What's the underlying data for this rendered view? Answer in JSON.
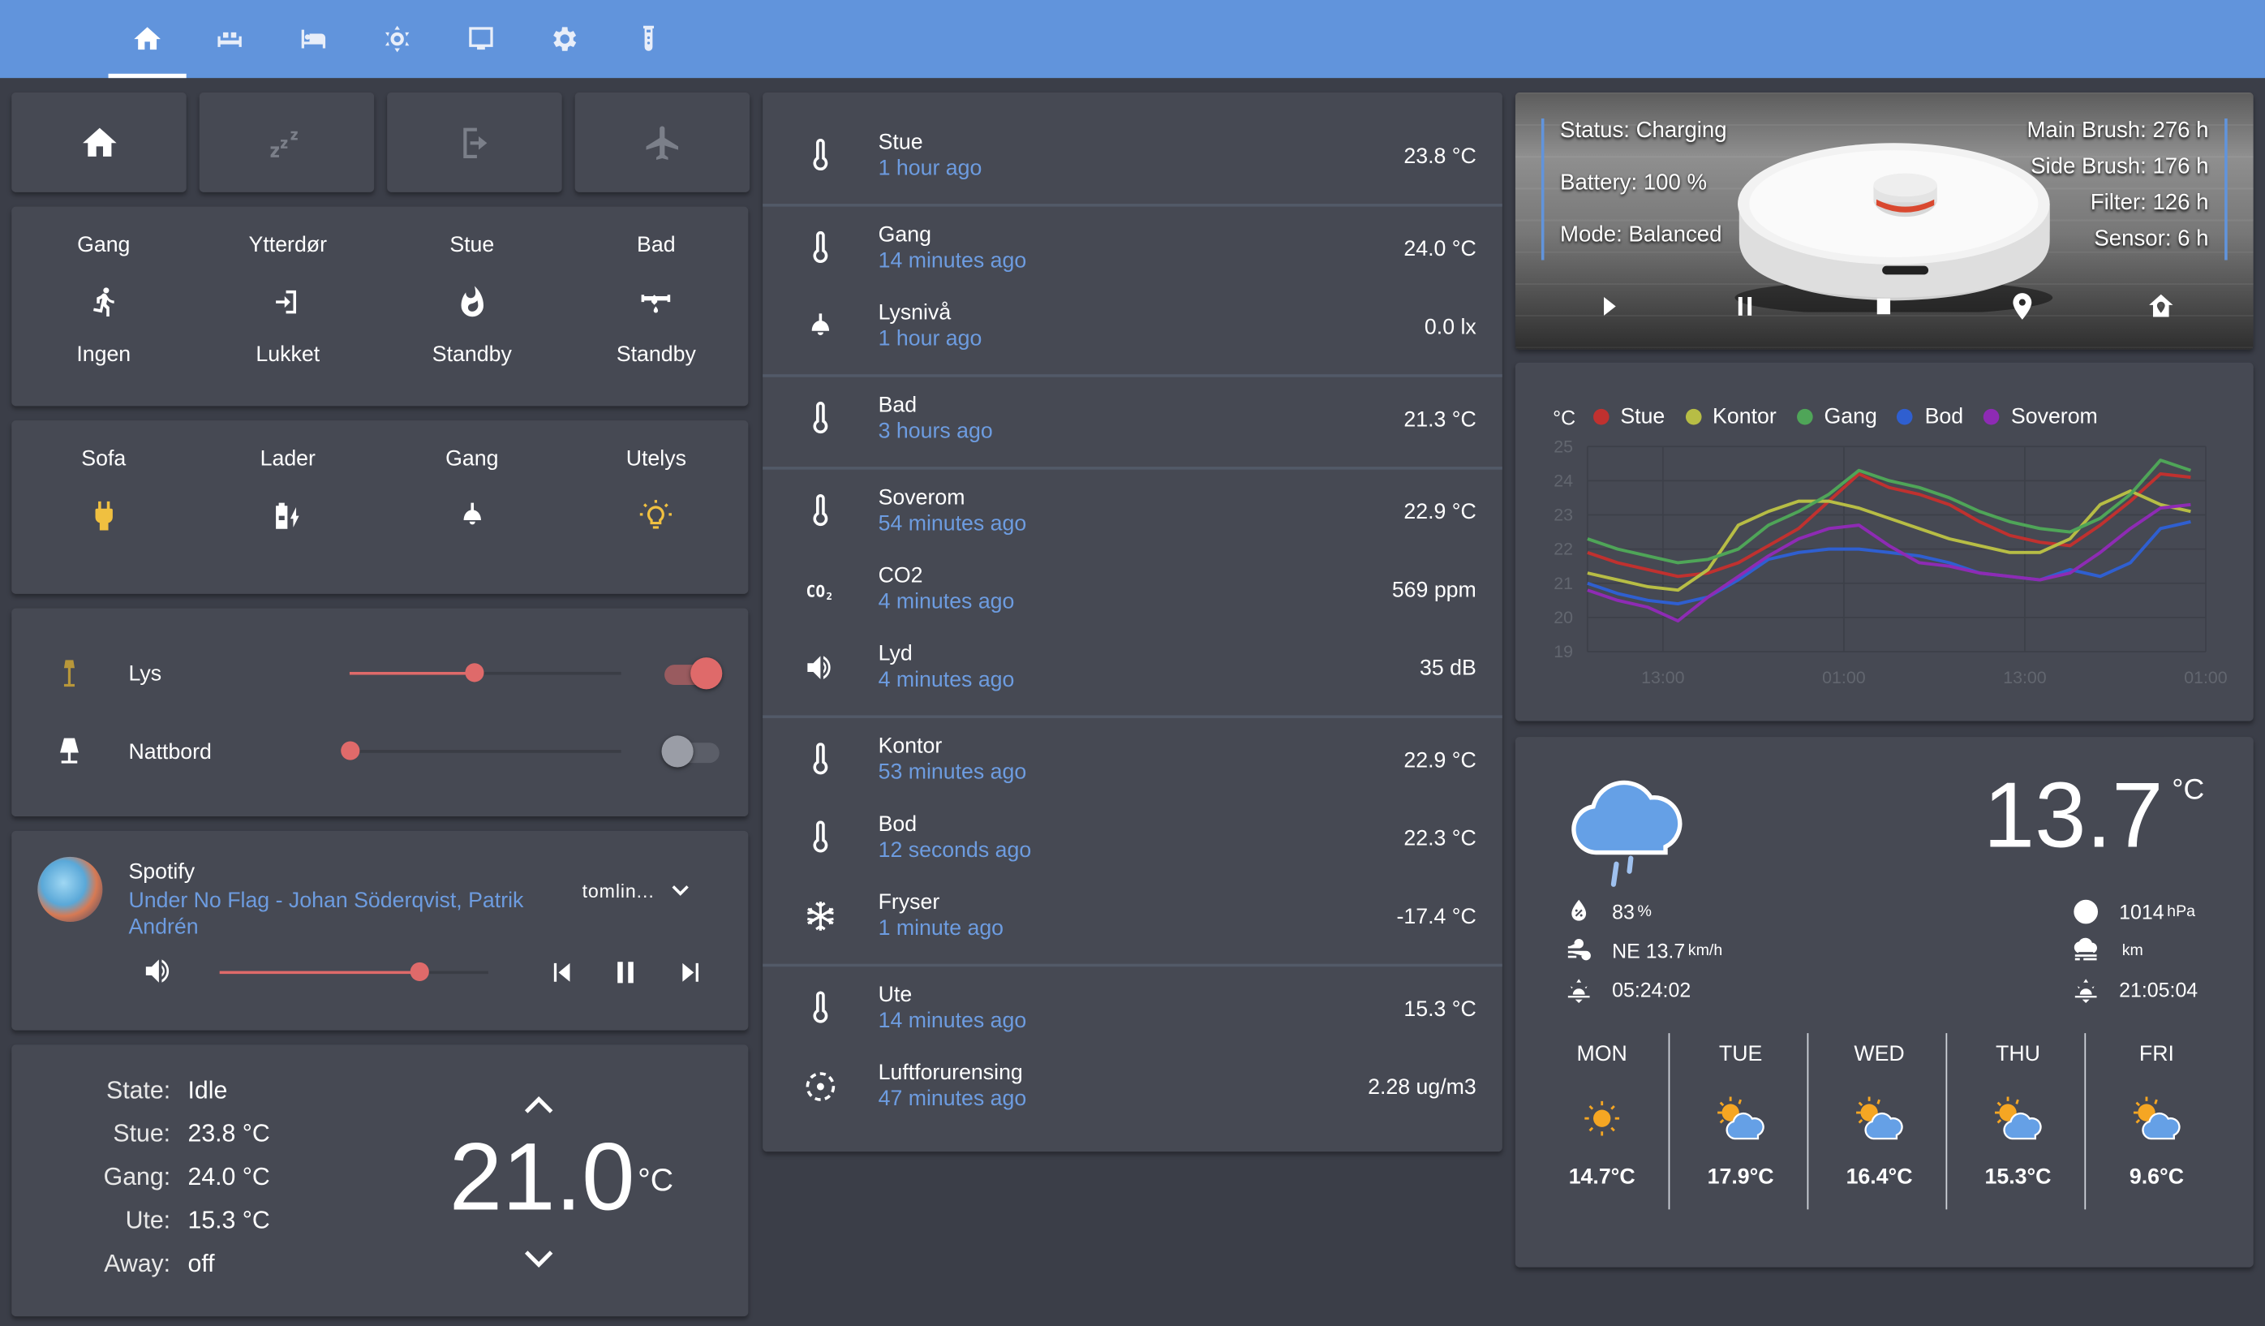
{
  "header": {
    "tabs": [
      {
        "icon": "home-icon",
        "active": true
      },
      {
        "icon": "sofa-icon",
        "active": false
      },
      {
        "icon": "bed-icon",
        "active": false
      },
      {
        "icon": "brightness-icon",
        "active": false
      },
      {
        "icon": "monitor-icon",
        "active": false
      },
      {
        "icon": "gear-icon",
        "active": false
      },
      {
        "icon": "test-tube-icon",
        "active": false
      }
    ]
  },
  "modes": [
    {
      "icon": "home-icon",
      "active": true
    },
    {
      "icon": "sleep-icon",
      "active": false
    },
    {
      "icon": "exit-icon",
      "active": false
    },
    {
      "icon": "airplane-icon",
      "active": false
    }
  ],
  "binary_sensors": [
    {
      "name": "Gang",
      "icon": "motion-icon",
      "state": "Ingen"
    },
    {
      "name": "Ytterdør",
      "icon": "door-icon",
      "state": "Lukket"
    },
    {
      "name": "Stue",
      "icon": "fire-icon",
      "state": "Standby"
    },
    {
      "name": "Bad",
      "icon": "water-pipe-icon",
      "state": "Standby"
    }
  ],
  "switches": [
    {
      "name": "Sofa",
      "icon": "power-plug-icon",
      "on": true
    },
    {
      "name": "Lader",
      "icon": "battery-charging-icon",
      "on": false
    },
    {
      "name": "Gang",
      "icon": "ceiling-light-icon",
      "on": false
    },
    {
      "name": "Utelys",
      "icon": "lightbulb-icon",
      "on": true
    }
  ],
  "lights": [
    {
      "name": "Lys",
      "icon": "floor-lamp-icon",
      "brightness_pct": 46,
      "on": true
    },
    {
      "name": "Nattbord",
      "icon": "table-lamp-icon",
      "brightness_pct": 0,
      "on": false
    }
  ],
  "media": {
    "app": "Spotify",
    "track": "Under No Flag - Johan Söderqvist, Patrik Andrén",
    "source": "tomlin...",
    "volume_pct": 74
  },
  "thermostat": {
    "rows": [
      {
        "label": "State:",
        "value": "Idle"
      },
      {
        "label": "Stue:",
        "value": "23.8 °C"
      },
      {
        "label": "Gang:",
        "value": "24.0 °C"
      },
      {
        "label": "Ute:",
        "value": "15.3 °C"
      },
      {
        "label": "Away:",
        "value": "off"
      }
    ],
    "target": "21.0",
    "unit": "°C"
  },
  "entities": [
    {
      "name": "Stue",
      "time": "1 hour ago",
      "value": "23.8 °C",
      "icon": "thermometer-icon"
    },
    {
      "name": "Gang",
      "time": "14 minutes ago",
      "value": "24.0 °C",
      "icon": "thermometer-icon"
    },
    {
      "name": "Lysnivå",
      "time": "1 hour ago",
      "value": "0.0 lx",
      "icon": "ceiling-light-icon"
    },
    {
      "name": "Bad",
      "time": "3 hours ago",
      "value": "21.3 °C",
      "icon": "thermometer-icon"
    },
    {
      "name": "Soverom",
      "time": "54 minutes ago",
      "value": "22.9 °C",
      "icon": "thermometer-icon"
    },
    {
      "name": "CO2",
      "time": "4 minutes ago",
      "value": "569 ppm",
      "icon": "co2-icon"
    },
    {
      "name": "Lyd",
      "time": "4 minutes ago",
      "value": "35 dB",
      "icon": "volume-icon"
    },
    {
      "name": "Kontor",
      "time": "53 minutes ago",
      "value": "22.9 °C",
      "icon": "thermometer-icon"
    },
    {
      "name": "Bod",
      "time": "12 seconds ago",
      "value": "22.3 °C",
      "icon": "thermometer-icon"
    },
    {
      "name": "Fryser",
      "time": "1 minute ago",
      "value": "-17.4 °C",
      "icon": "snowflake-icon"
    },
    {
      "name": "Ute",
      "time": "14 minutes ago",
      "value": "15.3 °C",
      "icon": "thermometer-icon"
    },
    {
      "name": "Luftforurensing",
      "time": "47 minutes ago",
      "value": "2.28 ug/m3",
      "icon": "air-quality-icon"
    }
  ],
  "vacuum": {
    "left": [
      "Status: Charging",
      "Battery: 100 %",
      "Mode: Balanced"
    ],
    "right": [
      "Main Brush: 276 h",
      "Side Brush: 176 h",
      "Filter: 126 h",
      "Sensor: 6 h"
    ],
    "accent": "#6194dc"
  },
  "chart_data": {
    "type": "line",
    "title": "",
    "ylabel": "°C",
    "xlabel": "",
    "ylim": [
      19,
      25
    ],
    "yticks": [
      "25",
      "24",
      "23",
      "22",
      "21",
      "20",
      "19"
    ],
    "xticks": [
      "13:00",
      "01:00",
      "13:00",
      "01:00"
    ],
    "grid": true,
    "legend": "top-left",
    "x_hours": [
      0,
      2,
      4,
      6,
      8,
      10,
      12,
      14,
      16,
      18,
      20,
      22,
      24,
      26,
      28,
      30,
      32,
      34,
      36,
      38,
      40
    ],
    "xtick_hours": [
      5,
      17,
      29,
      41
    ],
    "series": [
      {
        "name": "Stue",
        "color": "#c0312f",
        "values": [
          21.9,
          21.6,
          21.4,
          21.2,
          21.3,
          21.6,
          22.1,
          22.6,
          23.4,
          24.2,
          23.8,
          23.6,
          23.3,
          22.8,
          22.4,
          22.2,
          22.1,
          22.7,
          23.4,
          24.2,
          24.1
        ]
      },
      {
        "name": "Kontor",
        "color": "#b7bd45",
        "values": [
          21.3,
          21.1,
          20.9,
          20.8,
          21.4,
          22.7,
          23.1,
          23.4,
          23.4,
          23.2,
          22.9,
          22.6,
          22.3,
          22.1,
          21.9,
          21.9,
          22.3,
          23.3,
          23.7,
          23.3,
          23.1
        ]
      },
      {
        "name": "Gang",
        "color": "#4fa558",
        "values": [
          22.3,
          22.0,
          21.8,
          21.6,
          21.7,
          22.0,
          22.7,
          23.1,
          23.6,
          24.3,
          24.0,
          23.8,
          23.5,
          23.1,
          22.8,
          22.6,
          22.5,
          22.9,
          23.6,
          24.6,
          24.3
        ]
      },
      {
        "name": "Bod",
        "color": "#2f5fd0",
        "values": [
          21.0,
          20.7,
          20.5,
          20.4,
          20.6,
          21.1,
          21.7,
          21.9,
          22.0,
          22.0,
          21.9,
          21.8,
          21.6,
          21.3,
          21.2,
          21.1,
          21.4,
          21.2,
          21.6,
          22.6,
          22.8
        ]
      },
      {
        "name": "Soverom",
        "color": "#8e2bb4",
        "values": [
          20.8,
          20.5,
          20.3,
          19.9,
          20.6,
          21.2,
          21.8,
          22.3,
          22.6,
          22.7,
          22.1,
          21.6,
          21.5,
          21.3,
          21.2,
          21.1,
          21.3,
          21.9,
          22.6,
          23.2,
          23.3
        ]
      }
    ]
  },
  "weather": {
    "temp": "13.7",
    "unit": "°C",
    "humidity": "83",
    "humidity_unit": "%",
    "wind": "NE 13.7",
    "wind_unit": "km/h",
    "sunrise": "05:24:02",
    "pressure": "1014",
    "pressure_unit": "hPa",
    "visibility_unit": "km",
    "sunset": "21:05:04",
    "forecast": [
      {
        "day": "MON",
        "icon": "sunny-icon",
        "temp": "14.7°C"
      },
      {
        "day": "TUE",
        "icon": "partly-cloudy-icon",
        "temp": "17.9°C"
      },
      {
        "day": "WED",
        "icon": "partly-cloudy-icon",
        "temp": "16.4°C"
      },
      {
        "day": "THU",
        "icon": "partly-cloudy-icon",
        "temp": "15.3°C"
      },
      {
        "day": "FRI",
        "icon": "partly-cloudy-icon",
        "temp": "9.6°C"
      }
    ]
  },
  "colors": {
    "header": "#6194dc",
    "card": "#464953",
    "background": "#3b3e48",
    "accent_red": "#df6a6a",
    "secondary_text": "#6d9ce0",
    "yellow": "#f0c040"
  }
}
